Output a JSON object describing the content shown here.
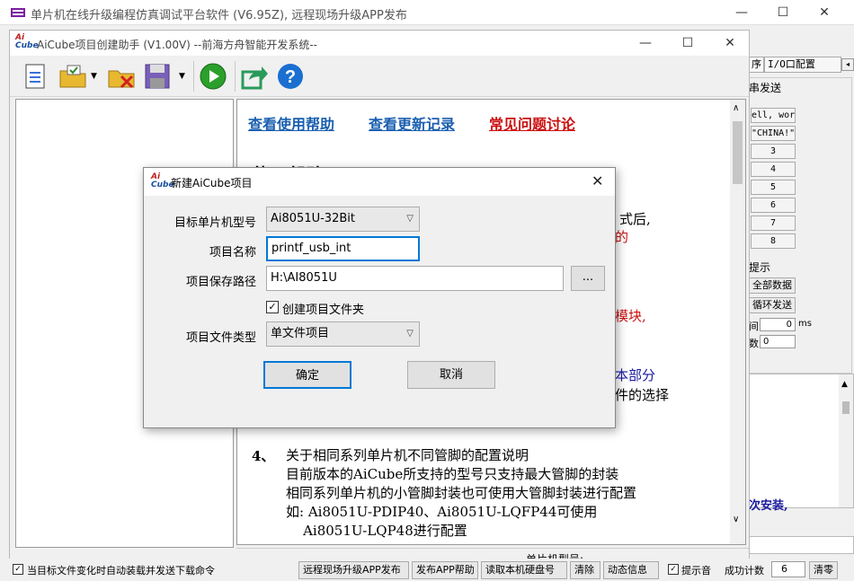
{
  "outer": {
    "title": "单片机在线升级编程仿真调试平台软件 (V6.95Z), 远程现场升级APP发布",
    "right_panel": {
      "tabs": [
        "序",
        "I/O口配置"
      ],
      "header": "串发送",
      "boxes": [
        "ell, wor",
        "\"CHINA!\"",
        "3",
        "4",
        "5",
        "6",
        "7",
        "8"
      ],
      "hint_label": "提示",
      "all_data_button": "全部数据",
      "loop_send_button": "循环发送",
      "interval_label": "间",
      "interval_value": "0",
      "interval_unit": "ms",
      "count_label": "数",
      "count_value": "0",
      "install_text": "次安装,"
    },
    "bottom": {
      "auto_load_checkbox": "当目标文件变化时自动装载并发送下载命令",
      "remote_upgrade_button": "远程现场升级APP发布",
      "publish_help_button": "发布APP帮助",
      "read_id_button": "读取本机硬盘号",
      "clear_button": "清除",
      "animation_button": "动态信息",
      "tip_checkbox": "提示音",
      "success_count_label": "成功计数",
      "success_count_value": "6",
      "reset_button": "清零"
    }
  },
  "inner": {
    "title": "AiCube项目创建助手 (V1.00V) --前海方舟智能开发系统--",
    "links": [
      "查看使用帮助",
      "查看更新记录",
      "常见问题讨论"
    ],
    "heading_partial": "使用帮助",
    "fragments": {
      "f1": "式后,",
      "f2": "的",
      "f3": "模块,",
      "f4": "本部分",
      "f5": "件的选择"
    },
    "item4_number": "4、",
    "item4_lines": [
      "关于相同系列单片机不同管脚的配置说明",
      "目前版本的AiCube所支持的型号只支持最大管脚的封装",
      "相同系列单片机的小管脚封装也可使用大管脚封装进行配置",
      "如: Ai8051U-PDIP40、Ai8051U-LQFP44可使用",
      "    Ai8051U-LQP48进行配置"
    ],
    "status_label": "单片机型号:"
  },
  "dialog": {
    "title": "新建AiCube项目",
    "mcu_label": "目标单片机型号",
    "mcu_value": "Ai8051U-32Bit",
    "name_label": "项目名称",
    "name_value": "printf_usb_int",
    "path_label": "项目保存路径",
    "path_value": "H:\\AI8051U",
    "browse_label": "...",
    "create_folder_label": "创建项目文件夹",
    "type_label": "项目文件类型",
    "type_value": "单文件项目",
    "ok_label": "确定",
    "cancel_label": "取消"
  }
}
